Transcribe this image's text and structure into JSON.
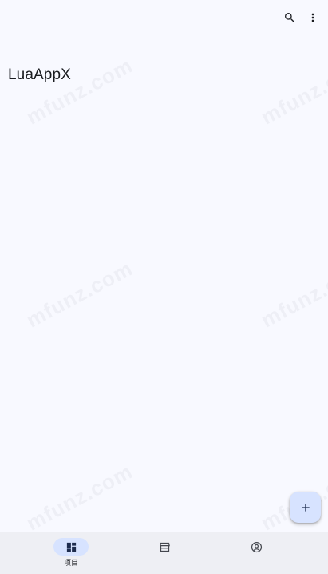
{
  "app": {
    "title": "LuaAppX"
  },
  "watermark": {
    "text": "mfunz.com"
  },
  "toolbar": {
    "search_icon": "search-icon",
    "more_icon": "more-vert-icon"
  },
  "fab": {
    "icon": "add-icon"
  },
  "bottom_nav": {
    "items": [
      {
        "label": "项目",
        "icon": "dashboard-icon",
        "selected": true
      },
      {
        "label": "",
        "icon": "storefront-icon",
        "selected": false
      },
      {
        "label": "",
        "icon": "account-circle-icon",
        "selected": false
      }
    ]
  },
  "colors": {
    "background": "#f8f9ff",
    "fab": "#d7e3ff",
    "nav_bar": "#eeeff4",
    "nav_indicator": "#d7e3ff",
    "icon": "#44474e",
    "active_icon": "#1d2c4d"
  }
}
